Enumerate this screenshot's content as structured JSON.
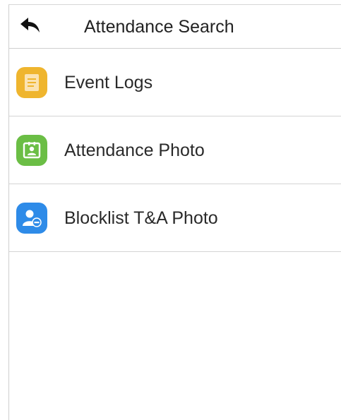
{
  "header": {
    "title": "Attendance Search",
    "back_icon": "back-arrow-icon"
  },
  "menu": {
    "items": [
      {
        "label": "Event Logs",
        "icon": "event-logs-icon",
        "color": "#EFB52E"
      },
      {
        "label": "Attendance Photo",
        "icon": "attendance-photo-icon",
        "color": "#6BBE45"
      },
      {
        "label": "Blocklist T&A Photo",
        "icon": "blocklist-photo-icon",
        "color": "#2E8BE8"
      }
    ]
  }
}
